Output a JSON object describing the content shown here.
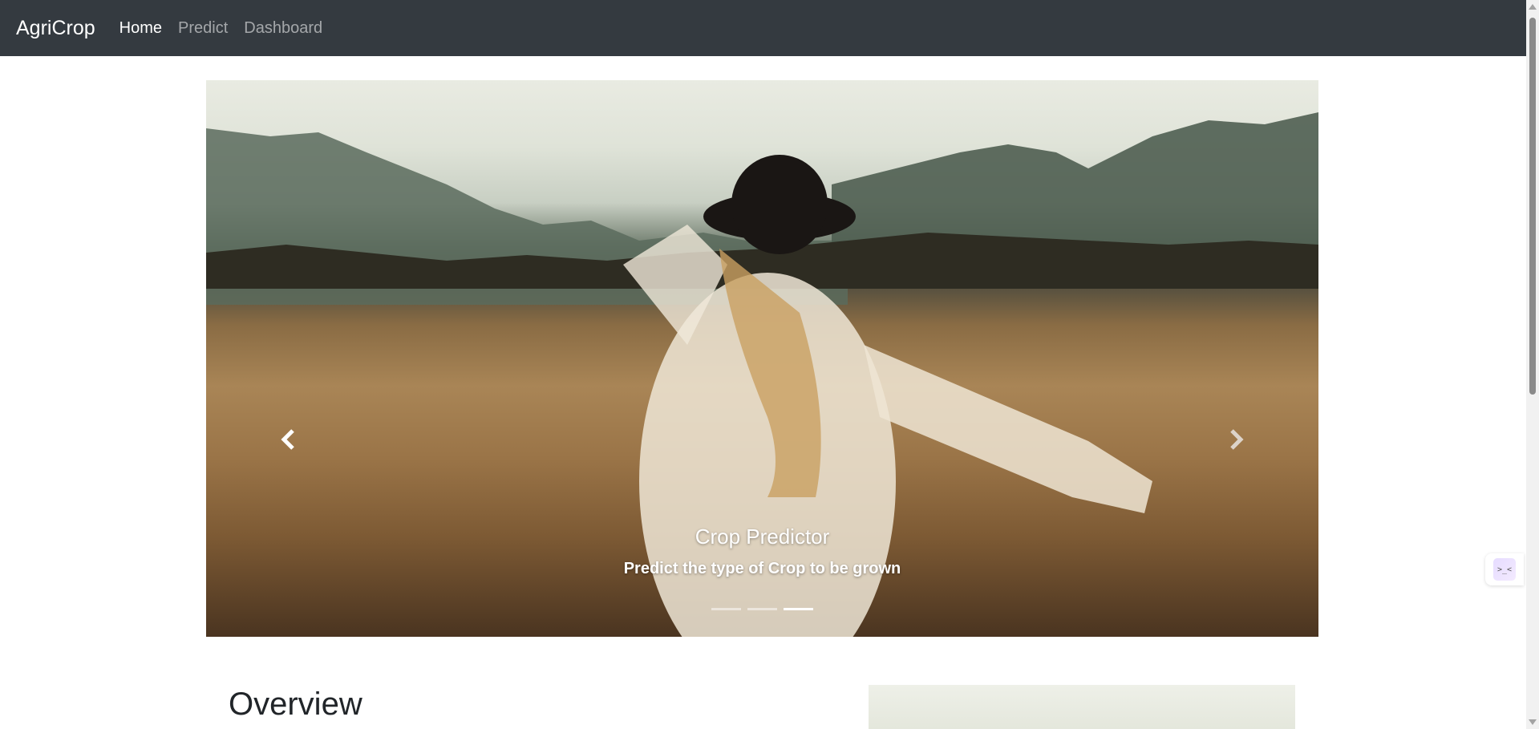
{
  "navbar": {
    "brand": "AgriCrop",
    "links": [
      {
        "label": "Home",
        "active": true
      },
      {
        "label": "Predict",
        "active": false
      },
      {
        "label": "Dashboard",
        "active": false
      }
    ],
    "background_color": "#343a40"
  },
  "carousel": {
    "caption_title": "Crop Predictor",
    "caption_subtitle": "Predict the type of Crop to be grown",
    "indicator_count": 3,
    "active_indicator": 3,
    "prev_icon": "chevron-left-icon",
    "next_icon": "chevron-right-icon"
  },
  "overview": {
    "title": "Overview"
  },
  "side_widget": {
    "icon_text": ">_<"
  }
}
